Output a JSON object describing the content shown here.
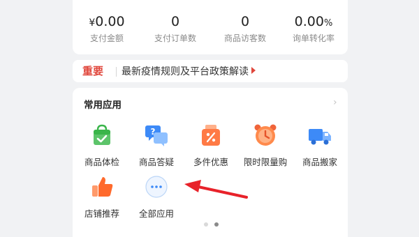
{
  "stats": [
    {
      "symbol": "¥",
      "value": "0.00",
      "suffix": "",
      "label": "支付金额"
    },
    {
      "symbol": "",
      "value": "0",
      "suffix": "",
      "label": "支付订单数"
    },
    {
      "symbol": "",
      "value": "0",
      "suffix": "",
      "label": "商品访客数"
    },
    {
      "symbol": "",
      "value": "0.00",
      "suffix": "%",
      "label": "询单转化率"
    }
  ],
  "notice": {
    "tag": "重要",
    "text": "最新疫情规则及平台政策解读"
  },
  "apps": {
    "title": "常用应用",
    "items": [
      {
        "label": "商品体检",
        "icon": "shopping-bag-check-icon"
      },
      {
        "label": "商品答疑",
        "icon": "question-chat-icon"
      },
      {
        "label": "多件优惠",
        "icon": "discount-bag-icon"
      },
      {
        "label": "限时限量购",
        "icon": "alarm-clock-icon"
      },
      {
        "label": "商品搬家",
        "icon": "truck-icon"
      },
      {
        "label": "店铺推荐",
        "icon": "thumbs-up-icon"
      },
      {
        "label": "全部应用",
        "icon": "more-dots-icon"
      }
    ]
  },
  "pagination": {
    "total": 2,
    "active": 2
  },
  "colors": {
    "accent": "#e0463b",
    "annotation_arrow": "#e8222a"
  }
}
